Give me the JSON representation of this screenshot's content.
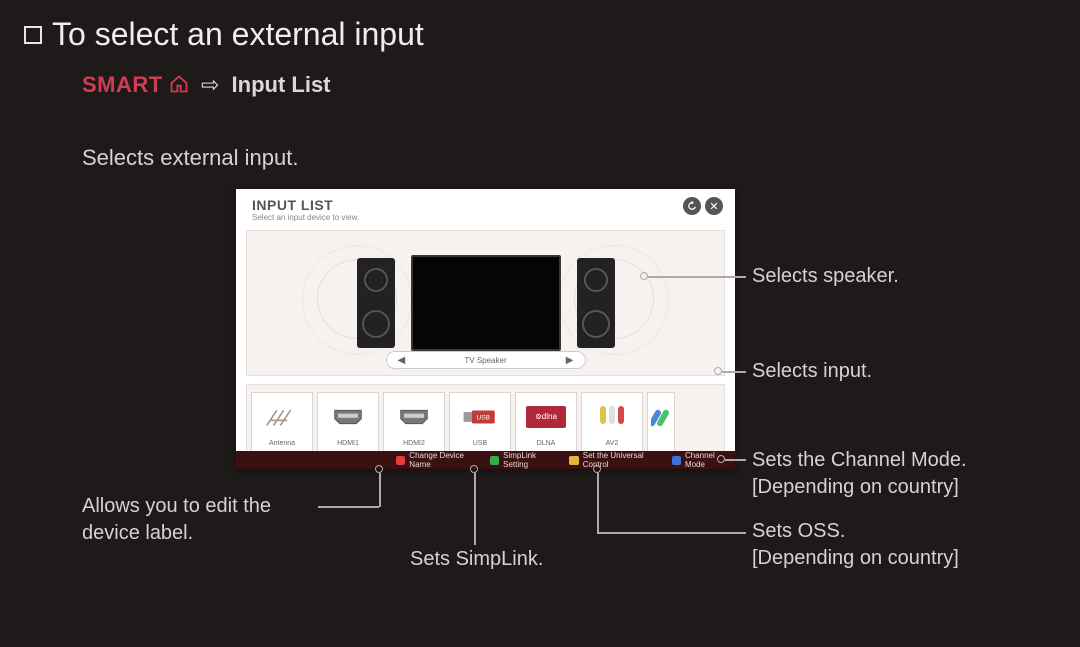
{
  "title": "To select an external input",
  "breadcrumb": {
    "smart": "SMART",
    "dest": "Input List"
  },
  "subtitle": "Selects external input.",
  "panel": {
    "title": "INPUT LIST",
    "subtitle": "Select an input device to view.",
    "speaker_label": "TV Speaker"
  },
  "inputs": [
    {
      "label": "Antenna"
    },
    {
      "label": "HDMI1"
    },
    {
      "label": "HDMI2"
    },
    {
      "label": "USB"
    },
    {
      "label": "DLNA"
    },
    {
      "label": "AV2"
    },
    {
      "label": ""
    }
  ],
  "colorbar": {
    "red": "Change Device Name",
    "green": "SimpLink Setting",
    "yellow": "Set the Universal Control",
    "blue": "Channel Mode"
  },
  "annotations": {
    "speaker": "Selects speaker.",
    "input": "Selects input.",
    "channel_mode_1": "Sets the Channel Mode.",
    "channel_mode_2": "[Depending on country]",
    "oss_1": "Sets OSS.",
    "oss_2": "[Depending on country]",
    "simplink": "Sets SimpLink.",
    "device_label_1": "Allows you to edit the",
    "device_label_2": "device label."
  }
}
